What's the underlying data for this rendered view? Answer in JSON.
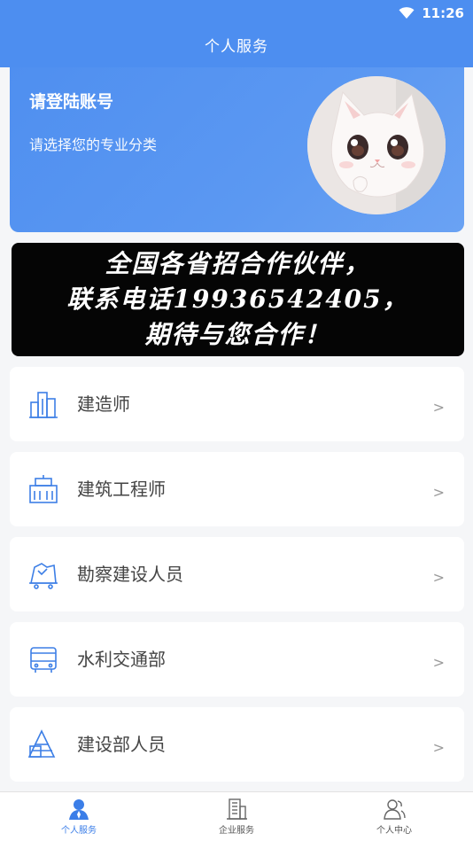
{
  "status_bar": {
    "time": "11:26"
  },
  "header": {
    "title": "个人服务"
  },
  "profile": {
    "login_prompt": "请登陆账号",
    "subtitle": "请选择您的专业分类"
  },
  "banner": {
    "lines": [
      "全国各省招合作伙伴，",
      "联系电话19936542405，",
      "期待与您合作！"
    ]
  },
  "list": {
    "items": [
      {
        "label": "建造师",
        "icon": "buildings-icon",
        "arrow": ">"
      },
      {
        "label": "建筑工程师",
        "icon": "building-icon",
        "arrow": ">"
      },
      {
        "label": "勘察建设人员",
        "icon": "survey-icon",
        "arrow": ">"
      },
      {
        "label": "水利交通部",
        "icon": "bus-icon",
        "arrow": ">"
      },
      {
        "label": "建设部人员",
        "icon": "stack-icon",
        "arrow": ">"
      }
    ]
  },
  "bottom_nav": {
    "items": [
      {
        "label": "个人服务",
        "icon": "person-icon",
        "active": true
      },
      {
        "label": "企业服务",
        "icon": "office-building-icon",
        "active": false
      },
      {
        "label": "个人中心",
        "icon": "user-group-icon",
        "active": false
      }
    ]
  },
  "colors": {
    "primary": "#4d8ef0",
    "active_nav": "#3b7ee8",
    "icon_blue": "#3d7fe6",
    "background": "#f5f6f8"
  }
}
